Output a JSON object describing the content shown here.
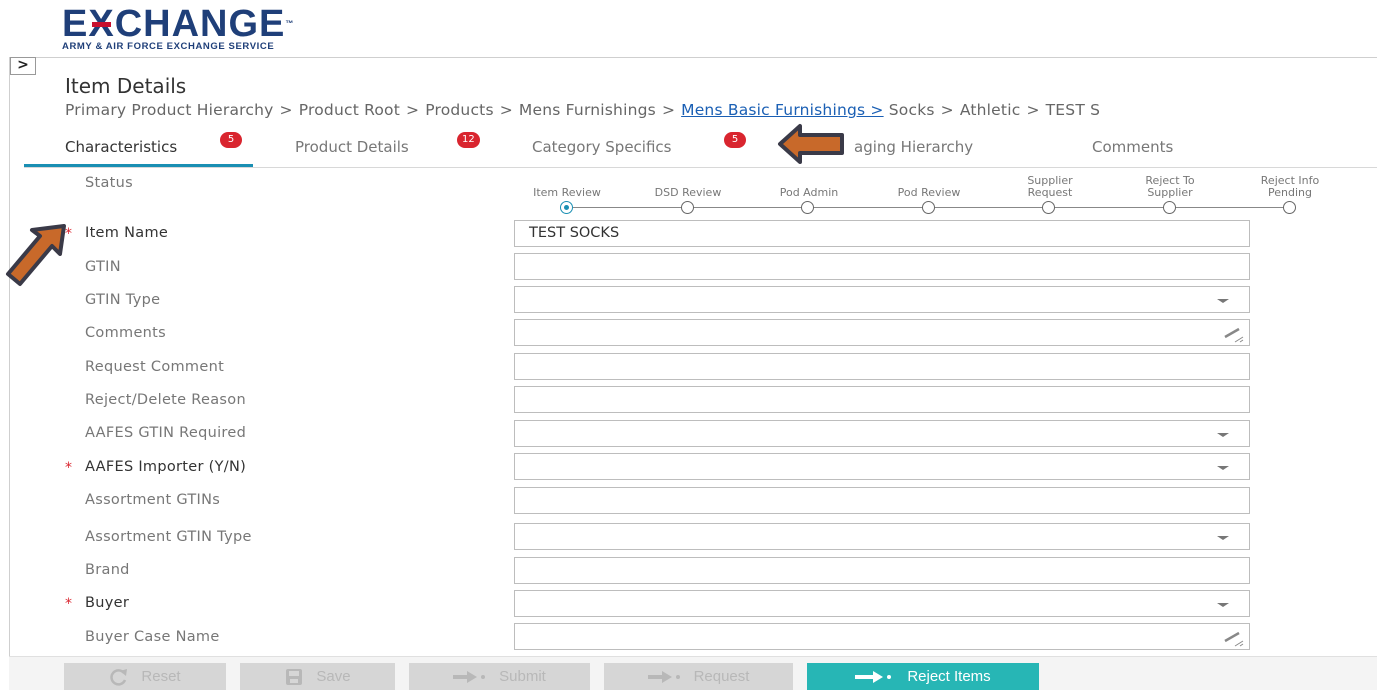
{
  "logo": {
    "main": "EXCHANGE",
    "tm": "™",
    "sub": "ARMY & AIR FORCE EXCHANGE SERVICE"
  },
  "toggle_label": ">",
  "page_title": "Item Details",
  "breadcrumb": {
    "items": [
      "Primary Product Hierarchy",
      "Product Root",
      "Products",
      "Mens Furnishings"
    ],
    "link": "Mens Basic Furnishings >",
    "tail": [
      "Socks",
      "Athletic",
      "TEST S"
    ],
    "separator": ">"
  },
  "tabs": [
    {
      "label": "Characteristics",
      "badge": "5"
    },
    {
      "label": "Product Details",
      "badge": "12"
    },
    {
      "label": "Category Specifics",
      "badge": "5"
    },
    {
      "label": "aging Hierarchy",
      "badge": ""
    },
    {
      "label": "Comments",
      "badge": ""
    }
  ],
  "status": {
    "label": "Status",
    "steps": [
      "Item Review",
      "DSD Review",
      "Pod Admin",
      "Pod Review",
      "Supplier Request",
      "Reject To Supplier",
      "Reject Info Pending"
    ],
    "active_index": 0
  },
  "form": {
    "item_name": {
      "label": "Item Name",
      "value": "TEST SOCKS",
      "required": true
    },
    "gtin": {
      "label": "GTIN",
      "value": ""
    },
    "gtin_type": {
      "label": "GTIN Type",
      "value": ""
    },
    "comments": {
      "label": "Comments",
      "value": ""
    },
    "request_comment": {
      "label": "Request Comment",
      "value": ""
    },
    "reject_delete_reason": {
      "label": "Reject/Delete Reason",
      "value": ""
    },
    "aafes_gtin_required": {
      "label": "AAFES GTIN Required",
      "value": ""
    },
    "aafes_importer": {
      "label": "AAFES Importer (Y/N)",
      "value": "",
      "required": true
    },
    "assortment_gtins": {
      "label": "Assortment GTINs",
      "value": ""
    },
    "assortment_gtin_type": {
      "label": "Assortment GTIN Type",
      "value": ""
    },
    "brand": {
      "label": "Brand",
      "value": ""
    },
    "buyer": {
      "label": "Buyer",
      "value": "",
      "required": true
    },
    "buyer_case_name": {
      "label": "Buyer Case Name",
      "value": ""
    }
  },
  "required_marker": "*",
  "buttons": {
    "reset": "Reset",
    "save": "Save",
    "submit": "Submit",
    "request": "Request",
    "reject_items": "Reject Items"
  },
  "colors": {
    "brand_blue": "#1f3f79",
    "accent_teal": "#1a8fb3",
    "primary_button": "#27b6b5",
    "badge_red": "#d9252f",
    "annotation_arrow": "#c8692a"
  }
}
